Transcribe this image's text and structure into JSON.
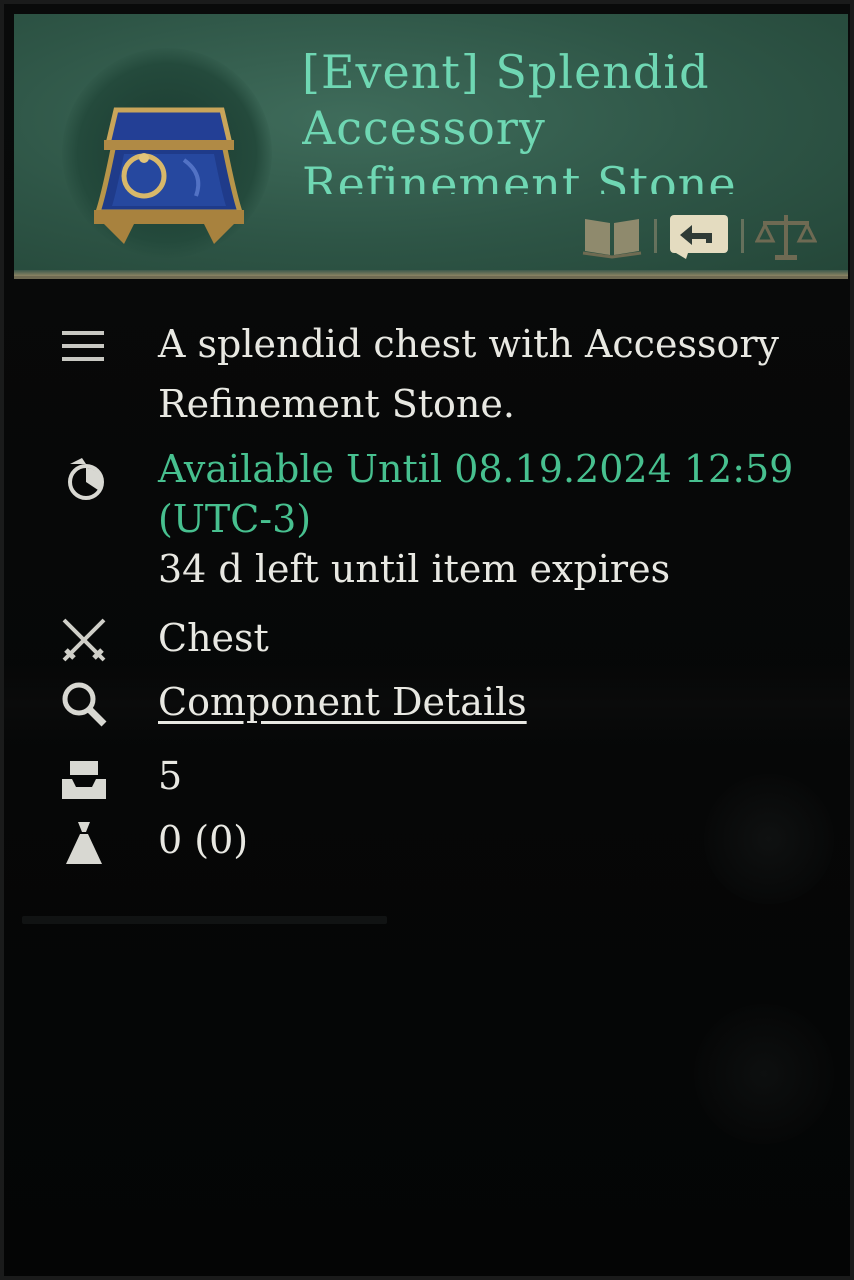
{
  "item": {
    "title": "[Event] Splendid Accessory Refinement Stone",
    "icon": "chest-icon"
  },
  "header_actions": [
    {
      "icon": "book-icon"
    },
    {
      "icon": "return-arrow-icon"
    },
    {
      "icon": "scales-icon"
    }
  ],
  "rows": {
    "description": "A splendid chest with Accessory Refinement Stone.",
    "availability": "Available Until 08.19.2024 12:59 (UTC-3)",
    "expires": "34 d left until item expires",
    "type": "Chest",
    "component_details": "Component Details",
    "quantity": "5",
    "weight": "0 (0)"
  },
  "colors": {
    "title": "#6fd7b3",
    "availability": "#47c08f",
    "link": "#7aa4f0",
    "header_bg": "#2e5546"
  }
}
